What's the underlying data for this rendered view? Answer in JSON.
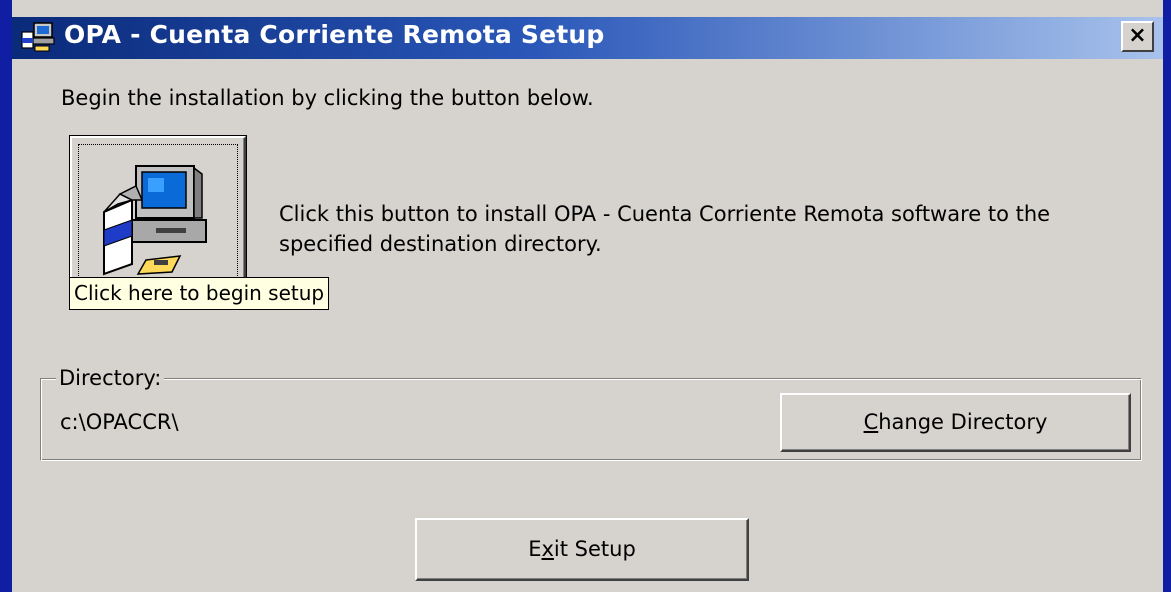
{
  "window": {
    "title": "OPA - Cuenta Corriente Remota Setup",
    "close_label": "×"
  },
  "intro_text": "Begin the installation by clicking the button below.",
  "setup_button": {
    "icon": "computer-setup-icon",
    "description_line1": "Click this button to install OPA - Cuenta Corriente Remota software to the",
    "description_line2": "specified destination directory."
  },
  "tooltip": "Click here to begin setup",
  "directory": {
    "group_label": "Directory:",
    "value": "c:\\OPACCR\\",
    "change_button": {
      "pre": "",
      "mnemonic": "C",
      "post": "hange Directory"
    }
  },
  "exit_button": {
    "pre": "E",
    "mnemonic": "x",
    "post": "it Setup"
  },
  "colors": {
    "titlebar_start": "#0a2a7a",
    "titlebar_end": "#a8c2ec",
    "dialog_bg": "#d6d3ce",
    "tooltip_bg": "#ffffe1"
  }
}
